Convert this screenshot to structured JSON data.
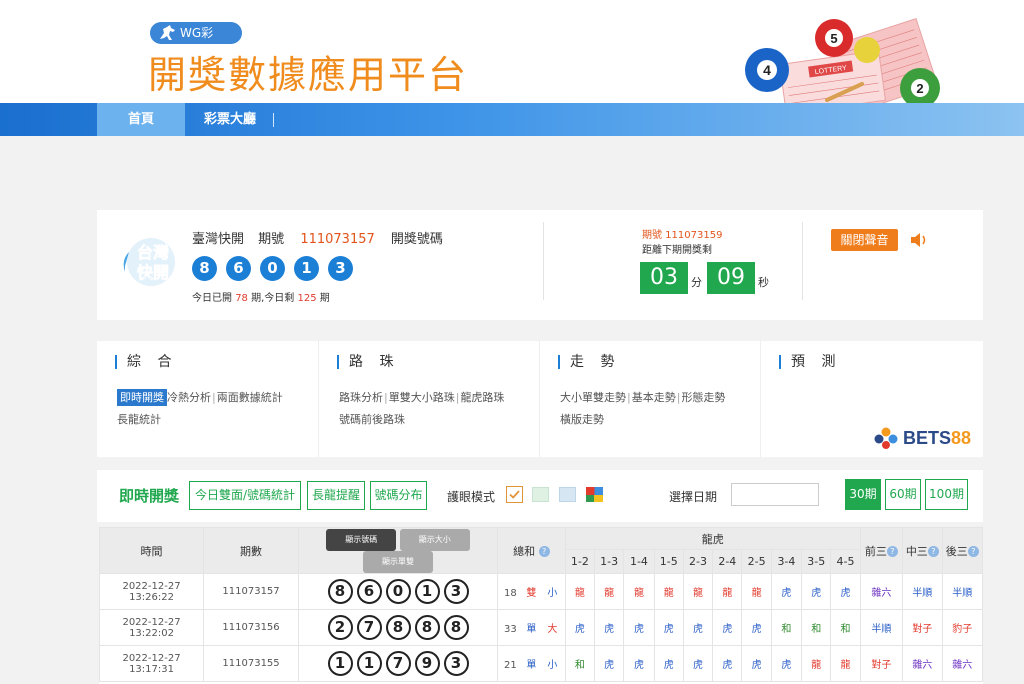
{
  "header": {
    "badge": "WG彩",
    "title": "開獎數據應用平台",
    "deco_ticket_text": "LOTTERY",
    "deco_balls": [
      "5",
      "4",
      "2"
    ]
  },
  "nav": {
    "home": "首頁",
    "hall": "彩票大廳"
  },
  "draw": {
    "logo_line1": "台灣",
    "logo_line2": "快開",
    "lottery_name": "臺灣快開",
    "period_label": "期號",
    "period": "111073157",
    "result_label": "開獎號碼",
    "balls": [
      "8",
      "6",
      "0",
      "1",
      "3"
    ],
    "today_prefix": "今日已開",
    "opened": "78",
    "today_mid": "期,今日剩",
    "remaining": "125",
    "today_suffix": "期",
    "next_period_text": "期號 111073159",
    "next_label": "距離下期開獎剩",
    "countdown_min": "03",
    "min_unit": "分",
    "countdown_sec": "09",
    "sec_unit": "秒",
    "mute_label": "關閉聲音"
  },
  "menu": {
    "sections": [
      {
        "title": "綜 合",
        "line1": [
          "即時開獎",
          "冷熱分析",
          "兩面數據統計"
        ],
        "line2": [
          "長龍統計"
        ]
      },
      {
        "title": "路 珠",
        "line1": [
          "路珠分析",
          "單雙大小路珠",
          "龍虎路珠"
        ],
        "line2": [
          "號碼前後路珠"
        ]
      },
      {
        "title": "走 勢",
        "line1": [
          "大小單雙走勢",
          "基本走勢",
          "形態走勢"
        ],
        "line2": [
          "橫版走勢"
        ]
      },
      {
        "title": "預 測",
        "line1": [],
        "line2": []
      }
    ],
    "sponsor": {
      "main": "BETS",
      "num": "88"
    }
  },
  "toolbar": {
    "title": "即時開獎",
    "btn_today": "今日雙面/號碼統計",
    "btn_dragon": "長龍提醒",
    "btn_dist": "號碼分布",
    "eye_label": "護眼模式",
    "date_label": "選擇日期",
    "date_value": "",
    "periods": [
      "30期",
      "60期",
      "100期"
    ],
    "active_period": "30期",
    "colors": {
      "accent": "#21a84f",
      "eye_check": "#e0953b"
    }
  },
  "table": {
    "headers": {
      "time": "時間",
      "period": "期數",
      "show_num": "顯示號碼",
      "show_size": "顯示大小",
      "show_oddeven": "顯示單雙",
      "sum": "總和",
      "dragon_tiger": "龍虎",
      "pairs": [
        "1-2",
        "1-3",
        "1-4",
        "1-5",
        "2-3",
        "2-4",
        "2-5",
        "3-4",
        "3-5",
        "4-5"
      ],
      "front": "前三",
      "mid": "中三",
      "back": "後三",
      "help": "?"
    },
    "rows": [
      {
        "time": "2022-12-27 13:26:22",
        "period": "111073157",
        "nums": [
          "8",
          "6",
          "0",
          "1",
          "3"
        ],
        "sum": "18",
        "oe": "雙",
        "size": "小",
        "dt": [
          "龍",
          "龍",
          "龍",
          "龍",
          "龍",
          "龍",
          "龍",
          "虎",
          "虎",
          "虎"
        ],
        "front": "雜六",
        "mid": "半順",
        "back": "半順"
      },
      {
        "time": "2022-12-27 13:22:02",
        "period": "111073156",
        "nums": [
          "2",
          "7",
          "8",
          "8",
          "8"
        ],
        "sum": "33",
        "oe": "單",
        "size": "大",
        "dt": [
          "虎",
          "虎",
          "虎",
          "虎",
          "虎",
          "虎",
          "虎",
          "和",
          "和",
          "和"
        ],
        "front": "半順",
        "mid": "對子",
        "back": "豹子"
      },
      {
        "time": "2022-12-27 13:17:31",
        "period": "111073155",
        "nums": [
          "1",
          "1",
          "7",
          "9",
          "3"
        ],
        "sum": "21",
        "oe": "單",
        "size": "小",
        "dt": [
          "和",
          "虎",
          "虎",
          "虎",
          "虎",
          "虎",
          "虎",
          "虎",
          "龍",
          "龍"
        ],
        "front": "對子",
        "mid": "雜六",
        "back": "雜六"
      }
    ]
  }
}
